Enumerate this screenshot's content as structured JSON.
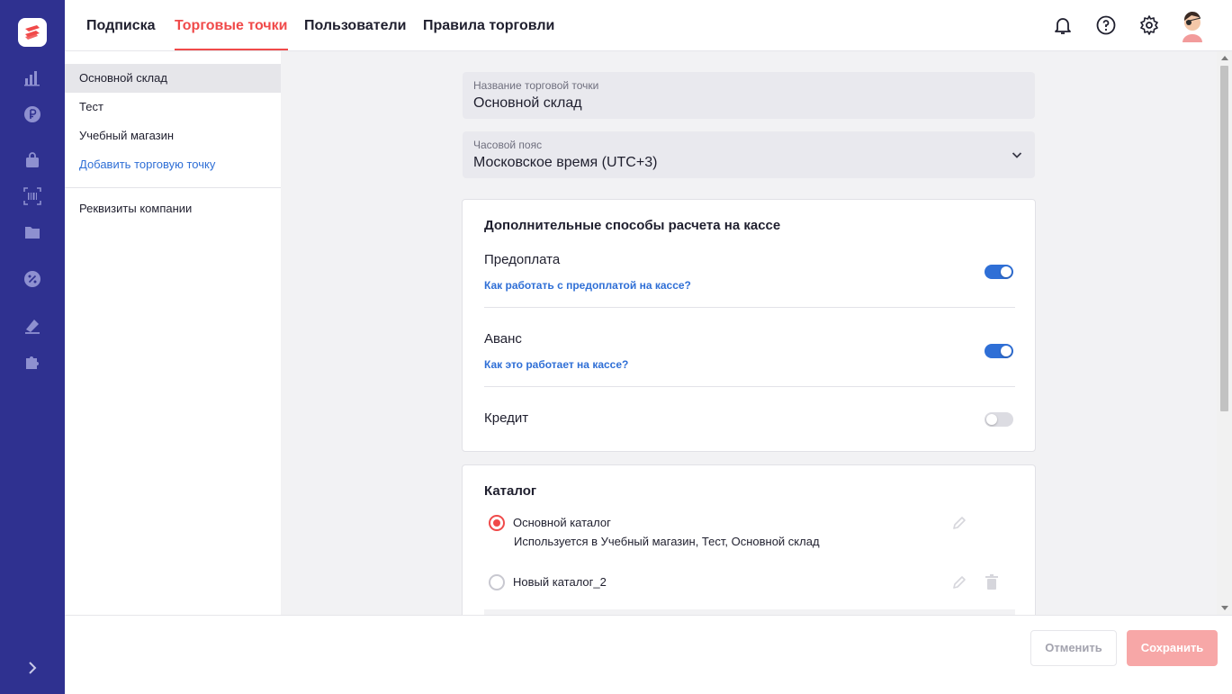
{
  "colors": {
    "rail_bg": "#2f3190",
    "accent_red": "#f04a4a",
    "link_blue": "#2f6fd6",
    "toggle_on": "#2f6fd6",
    "save_disabled": "#f7a7a7"
  },
  "rail": {
    "icons": [
      "logo-icon",
      "analytics-icon",
      "ruble-icon",
      "shopping-bag-icon",
      "barcode-scan-icon",
      "folder-icon",
      "discount-icon",
      "tag-icon",
      "puzzle-icon",
      "chevron-right-icon"
    ]
  },
  "topnav": {
    "tabs": [
      {
        "label": "Подписка",
        "active": false
      },
      {
        "label": "Торговые точки",
        "active": true
      },
      {
        "label": "Пользователи",
        "active": false
      },
      {
        "label": "Правила торговли",
        "active": false
      }
    ],
    "icons": [
      "bell-icon",
      "help-icon",
      "settings-icon",
      "avatar"
    ]
  },
  "sidebar": {
    "items": [
      {
        "label": "Основной склад",
        "selected": true
      },
      {
        "label": "Тест"
      },
      {
        "label": "Учебный магазин"
      },
      {
        "label": "Добавить торговую точку",
        "link": true
      }
    ],
    "bottom_items": [
      {
        "label": "Реквизиты компании"
      }
    ]
  },
  "form": {
    "name_field": {
      "label": "Название торговой точки",
      "value": "Основной склад"
    },
    "timezone_field": {
      "label": "Часовой пояс",
      "value": "Московское время (UTC+3)"
    }
  },
  "payments": {
    "title": "Дополнительные способы расчета на кассе",
    "options": [
      {
        "name": "Предоплата",
        "link": "Как работать с предоплатой на кассе?",
        "enabled": true
      },
      {
        "name": "Аванс",
        "link": "Как это работает на кассе?",
        "enabled": true
      },
      {
        "name": "Кредит",
        "link": "",
        "enabled": false
      }
    ]
  },
  "catalog": {
    "title": "Каталог",
    "items": [
      {
        "name": "Основной каталог",
        "subtitle": "Используется в Учебный магазин, Тест, Основной склад",
        "selected": true
      },
      {
        "name": "Новый каталог_2",
        "subtitle": "",
        "selected": false
      }
    ]
  },
  "footer": {
    "cancel_label": "Отменить",
    "save_label": "Сохранить"
  }
}
